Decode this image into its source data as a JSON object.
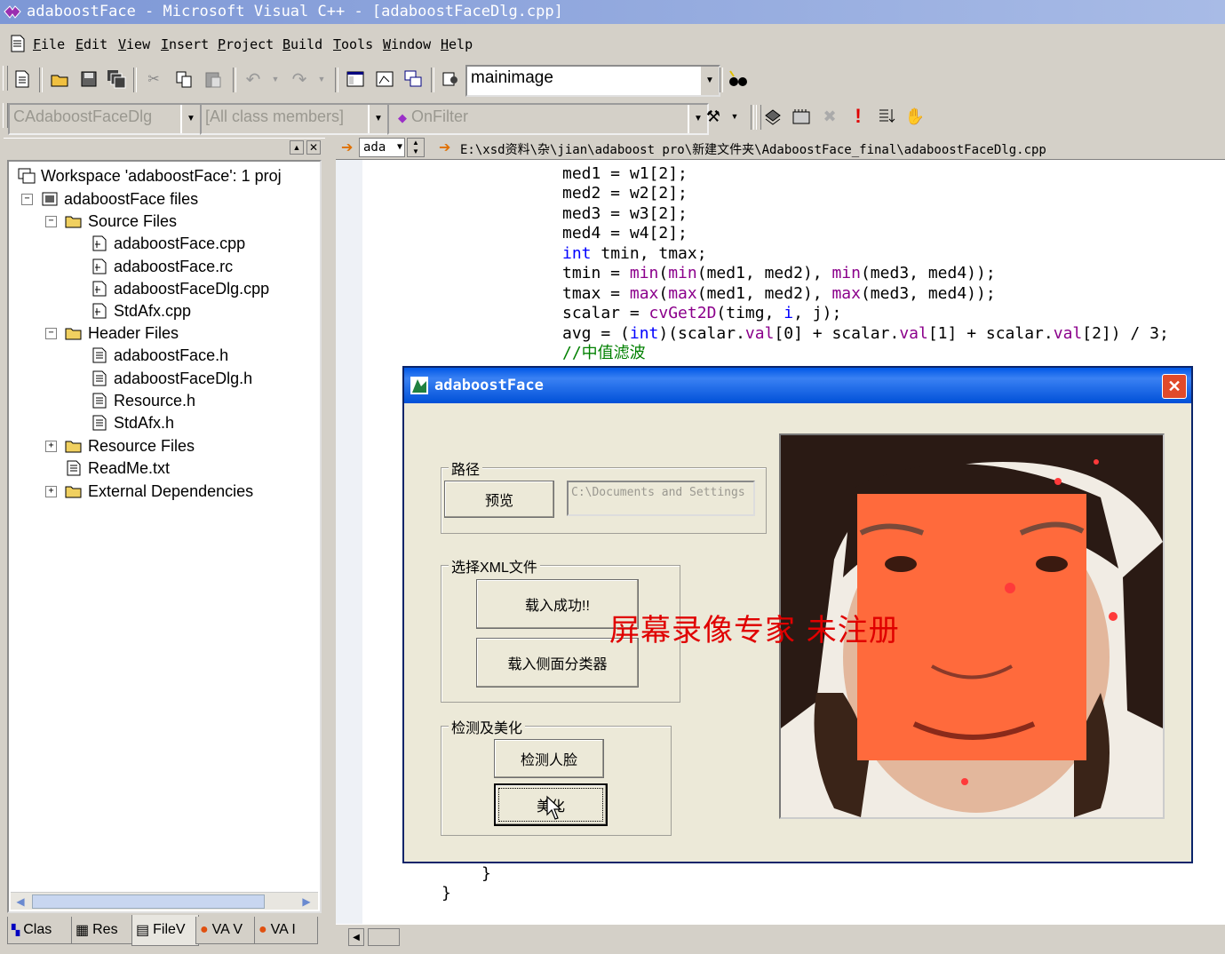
{
  "window": {
    "title": "adaboostFace - Microsoft Visual C++ - [adaboostFaceDlg.cpp]"
  },
  "menu": [
    "File",
    "Edit",
    "View",
    "Insert",
    "Project",
    "Build",
    "Tools",
    "Window",
    "Help"
  ],
  "toolbar": {
    "find_combo_value": "mainimage"
  },
  "wizardbar": {
    "class_combo": "CAdaboostFaceDlg",
    "filter_combo": "[All class members]",
    "member_combo": "OnFilter"
  },
  "editor": {
    "nav_combo": "ada",
    "file_path": "E:\\xsd资料\\杂\\jian\\adaboost pro\\新建文件夹\\AdaboostFace_final\\adaboostFaceDlg.cpp"
  },
  "workspace": {
    "root": "Workspace 'adaboostFace': 1 proj",
    "project": "adaboostFace files",
    "source_folder": "Source Files",
    "source_files": [
      "adaboostFace.cpp",
      "adaboostFace.rc",
      "adaboostFaceDlg.cpp",
      "StdAfx.cpp"
    ],
    "header_folder": "Header Files",
    "header_files": [
      "adaboostFace.h",
      "adaboostFaceDlg.h",
      "Resource.h",
      "StdAfx.h"
    ],
    "resource_folder": "Resource Files",
    "readme": "ReadMe.txt",
    "external": "External Dependencies",
    "tabs": [
      "Clas",
      "Res",
      "FileV",
      "VA V",
      "VA I"
    ]
  },
  "code_lines": [
    "med1 = w1[2];",
    "med2 = w2[2];",
    "med3 = w3[2];",
    "med4 = w4[2];"
  ],
  "code_tail": [
    "}",
    "}"
  ],
  "dialog": {
    "title": "adaboostFace",
    "group_path": "路径",
    "preview_button": "预览",
    "path_field": "C:\\Documents and Settings",
    "group_xml": "选择XML文件",
    "load_success_button": "载入成功!!",
    "load_side_button": "载入侧面分类器",
    "group_detect": "检测及美化",
    "detect_button": "检测人脸",
    "beautify_button": "美化"
  },
  "watermark": "屏幕录像专家  未注册",
  "colors": {
    "title_blue": "#0058e6",
    "face_overlay": "#ff6a3c",
    "watermark": "#e00000"
  }
}
